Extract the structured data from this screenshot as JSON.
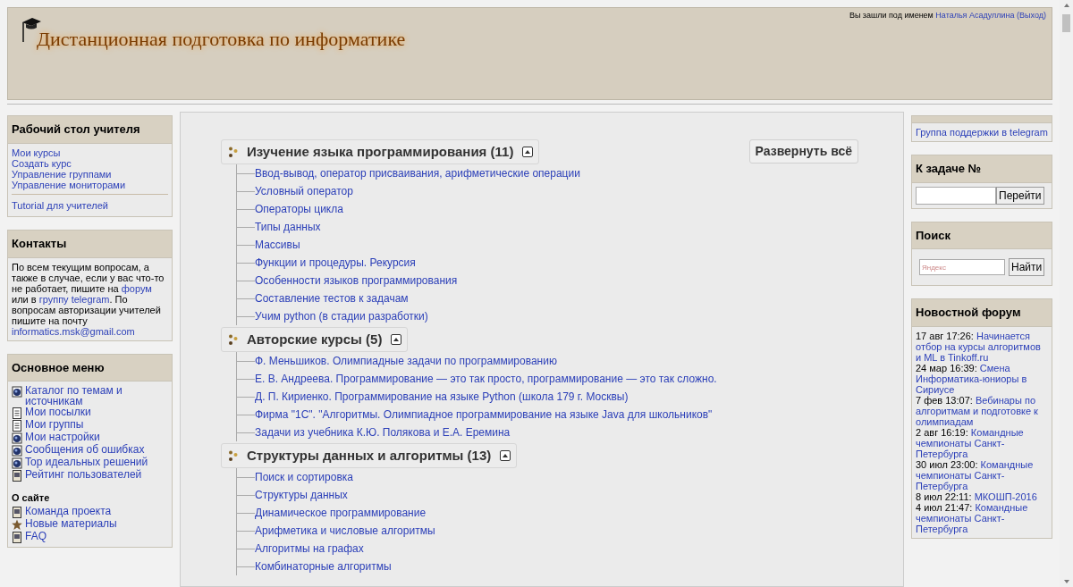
{
  "header": {
    "site_title": "Дистанционная подготовка по информатике",
    "login_prefix": "Вы зашли под именем",
    "user_name": "Наталья Асадуллина",
    "logout": "(Выход)"
  },
  "teacher_desk": {
    "title": "Рабочий стол учителя",
    "links": [
      "Мои курсы",
      "Создать курс",
      "Управление группами",
      "Управление мониторами"
    ],
    "extra_links": [
      "Tutorial для учителей"
    ]
  },
  "contacts": {
    "title": "Контакты",
    "parts": [
      {
        "text": "По всем текущим вопросам, а также в случае, если у вас что-то не работает, пишите на ",
        "link": false
      },
      {
        "text": "форум",
        "link": true
      },
      {
        "text": " или в ",
        "link": false
      },
      {
        "text": "группу telegram",
        "link": true
      },
      {
        "text": ". По вопросам авторизации учителей пишите на почту ",
        "link": false
      },
      {
        "text": "informatics.msk@gmail.com",
        "link": true
      }
    ]
  },
  "main_menu": {
    "title": "Основное меню",
    "items": [
      {
        "label": "Каталог по темам и источникам",
        "kind": "globe"
      },
      {
        "label": "Мои посылки",
        "kind": "doc"
      },
      {
        "label": "Мои группы",
        "kind": "doc"
      },
      {
        "label": "Мои настройки",
        "kind": "globe"
      },
      {
        "label": "Сообщения об ошибках",
        "kind": "globe"
      },
      {
        "label": "Top идеальных решений",
        "kind": "globe"
      },
      {
        "label": "Рейтинг пользователей",
        "kind": "page"
      }
    ],
    "about_title": "О сайте",
    "about_items": [
      {
        "label": "Команда проекта",
        "kind": "page"
      },
      {
        "label": "Новые материалы",
        "kind": "star"
      },
      {
        "label": "FAQ",
        "kind": "page"
      }
    ]
  },
  "expand_all": "Развернуть всё",
  "categories": [
    {
      "title": "Изучение языка программирования (11)",
      "expanded": true,
      "children": [
        "Ввод-вывод, оператор присваивания, арифметические операции",
        "Условный оператор",
        "Операторы цикла",
        "Типы данных",
        "Массивы",
        "Функции и процедуры. Рекурсия",
        "Особенности языков программирования",
        "Составление тестов к задачам",
        "Учим python (в стадии разработки)"
      ]
    },
    {
      "title": "Авторские курсы (5)",
      "expanded": true,
      "children": [
        "Ф. Меньшиков. Олимпиадные задачи по программированию",
        "Е. В. Андреева. Программирование — это так просто, программирование — это так сложно.",
        "Д. П. Кириенко. Программирование на языке Python (школа 179 г. Москвы)",
        "Фирма \"1С\". \"Алгоритмы. Олимпиадное программирование на языке Java для школьников\"",
        "Задачи из учебника К.Ю. Полякова и Е.А. Еремина"
      ]
    },
    {
      "title": "Структуры данных и алгоритмы (13)",
      "expanded": true,
      "children": [
        "Поиск и сортировка",
        "Структуры данных",
        "Динамическое программирование",
        "Арифметика и числовые алгоритмы",
        "Алгоритмы на графах",
        "Комбинаторные алгоритмы"
      ]
    }
  ],
  "support": {
    "link": "Группа поддержки в telegram"
  },
  "goto_task": {
    "title": "К задаче №",
    "button": "Перейти"
  },
  "search": {
    "title": "Поиск",
    "placeholder": "Яндекс",
    "button": "Найти"
  },
  "news": {
    "title": "Новостной форум",
    "items": [
      {
        "time": "17 авг 17:26:",
        "title": "Начинается отбор на курсы алгоритмов и ML в Tinkoff.ru"
      },
      {
        "time": "24 мар 16:39:",
        "title": "Смена Информатика-юниоры в Сириусе"
      },
      {
        "time": "7 фев 13:07:",
        "title": "Вебинары по алгоритмам и подготовке к олимпиадам"
      },
      {
        "time": "2 авг 16:19:",
        "title": "Командные чемпионаты Санкт-Петербурга"
      },
      {
        "time": "30 июл 23:00:",
        "title": "Командные чемпионаты Санкт-Петербурга"
      },
      {
        "time": "8 июл 22:11:",
        "title": "МКОШП-2016"
      },
      {
        "time": "4 июл 21:47:",
        "title": "Командные чемпионаты Санкт-Петербурга"
      }
    ]
  }
}
